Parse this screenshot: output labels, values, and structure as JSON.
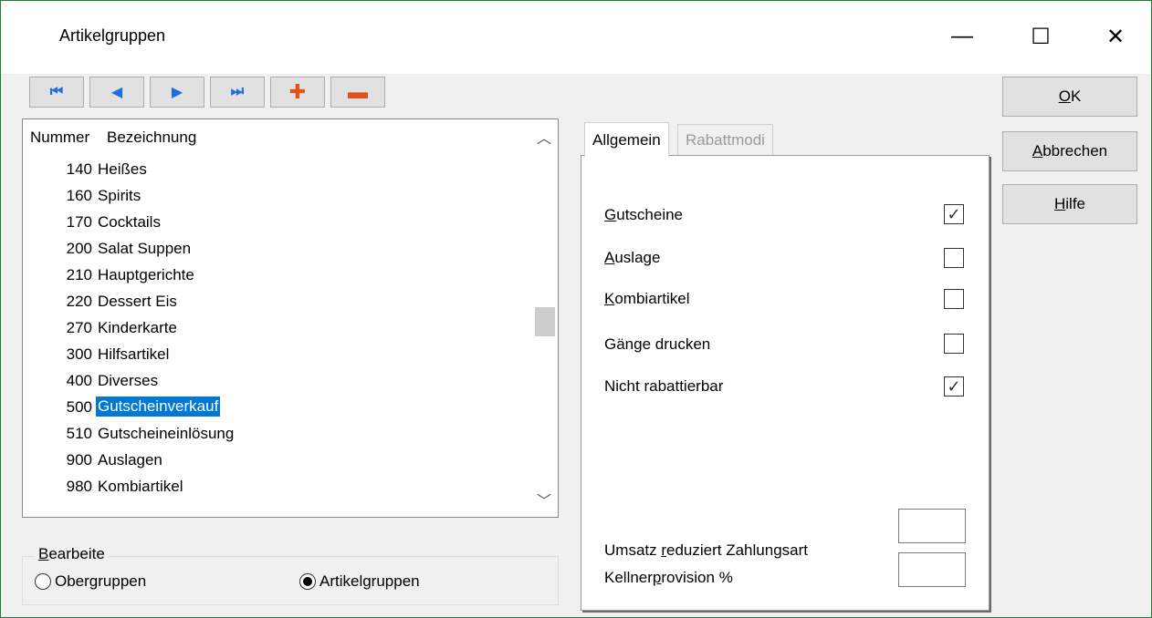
{
  "window": {
    "title": "Artikelgruppen",
    "controls": {
      "minimize": "—",
      "maximize": "☐",
      "close": "✕"
    }
  },
  "toolbar": {
    "first_icon": "⏮",
    "prev_icon": "◀",
    "next_icon": "▶",
    "last_icon": "⏭",
    "add_icon": "✚",
    "remove_icon": "▬"
  },
  "list": {
    "header_number": "Nummer",
    "header_name": "Bezeichnung",
    "rows": [
      {
        "num": "140",
        "label": "Heißes"
      },
      {
        "num": "160",
        "label": "Spirits"
      },
      {
        "num": "170",
        "label": "Cocktails"
      },
      {
        "num": "200",
        "label": "Salat Suppen"
      },
      {
        "num": "210",
        "label": "Hauptgerichte"
      },
      {
        "num": "220",
        "label": "Dessert Eis"
      },
      {
        "num": "270",
        "label": "Kinderkarte"
      },
      {
        "num": "300",
        "label": "Hilfsartikel"
      },
      {
        "num": "400",
        "label": "Diverses"
      },
      {
        "num": "500",
        "label": "Gutscheinverkauf",
        "selected": true
      },
      {
        "num": "510",
        "label": "Gutscheineinlösung"
      },
      {
        "num": "900",
        "label": "Auslagen"
      },
      {
        "num": "980",
        "label": "Kombiartikel"
      }
    ],
    "scroll_up": "︿",
    "scroll_down": "﹀"
  },
  "edit_group": {
    "legend_first": "B",
    "legend_rest": "earbeite",
    "options": [
      {
        "label": "Obergruppen",
        "checked": false
      },
      {
        "label": "Artikelgruppen",
        "checked": true
      }
    ]
  },
  "tabs": [
    {
      "label": "Allgemein",
      "active": true
    },
    {
      "label": "Rabattmodi",
      "active": false
    }
  ],
  "settings": {
    "gutscheine": {
      "first": "G",
      "rest": "utscheine",
      "checked": true
    },
    "auslage": {
      "first": "A",
      "rest": "uslage",
      "checked": false
    },
    "kombiartikel": {
      "first": "K",
      "rest": "ombiartikel",
      "checked": false
    },
    "gaenge": {
      "label": "Gänge drucken",
      "checked": false
    },
    "nicht_rabatt": {
      "label": "Nicht rabattierbar",
      "checked": true
    },
    "umsatz": {
      "before": "Umsatz ",
      "ul": "r",
      "after": "eduziert Zahlungsart",
      "value": ""
    },
    "kellner": {
      "before": "Kellner",
      "ul": "p",
      "after": "rovision %",
      "value": ""
    },
    "check_mark": "✓"
  },
  "buttons": {
    "ok": {
      "ul": "O",
      "rest": "K"
    },
    "cancel": {
      "ul": "A",
      "rest": "bbrechen"
    },
    "help": {
      "ul": "H",
      "rest": "ilfe"
    }
  }
}
